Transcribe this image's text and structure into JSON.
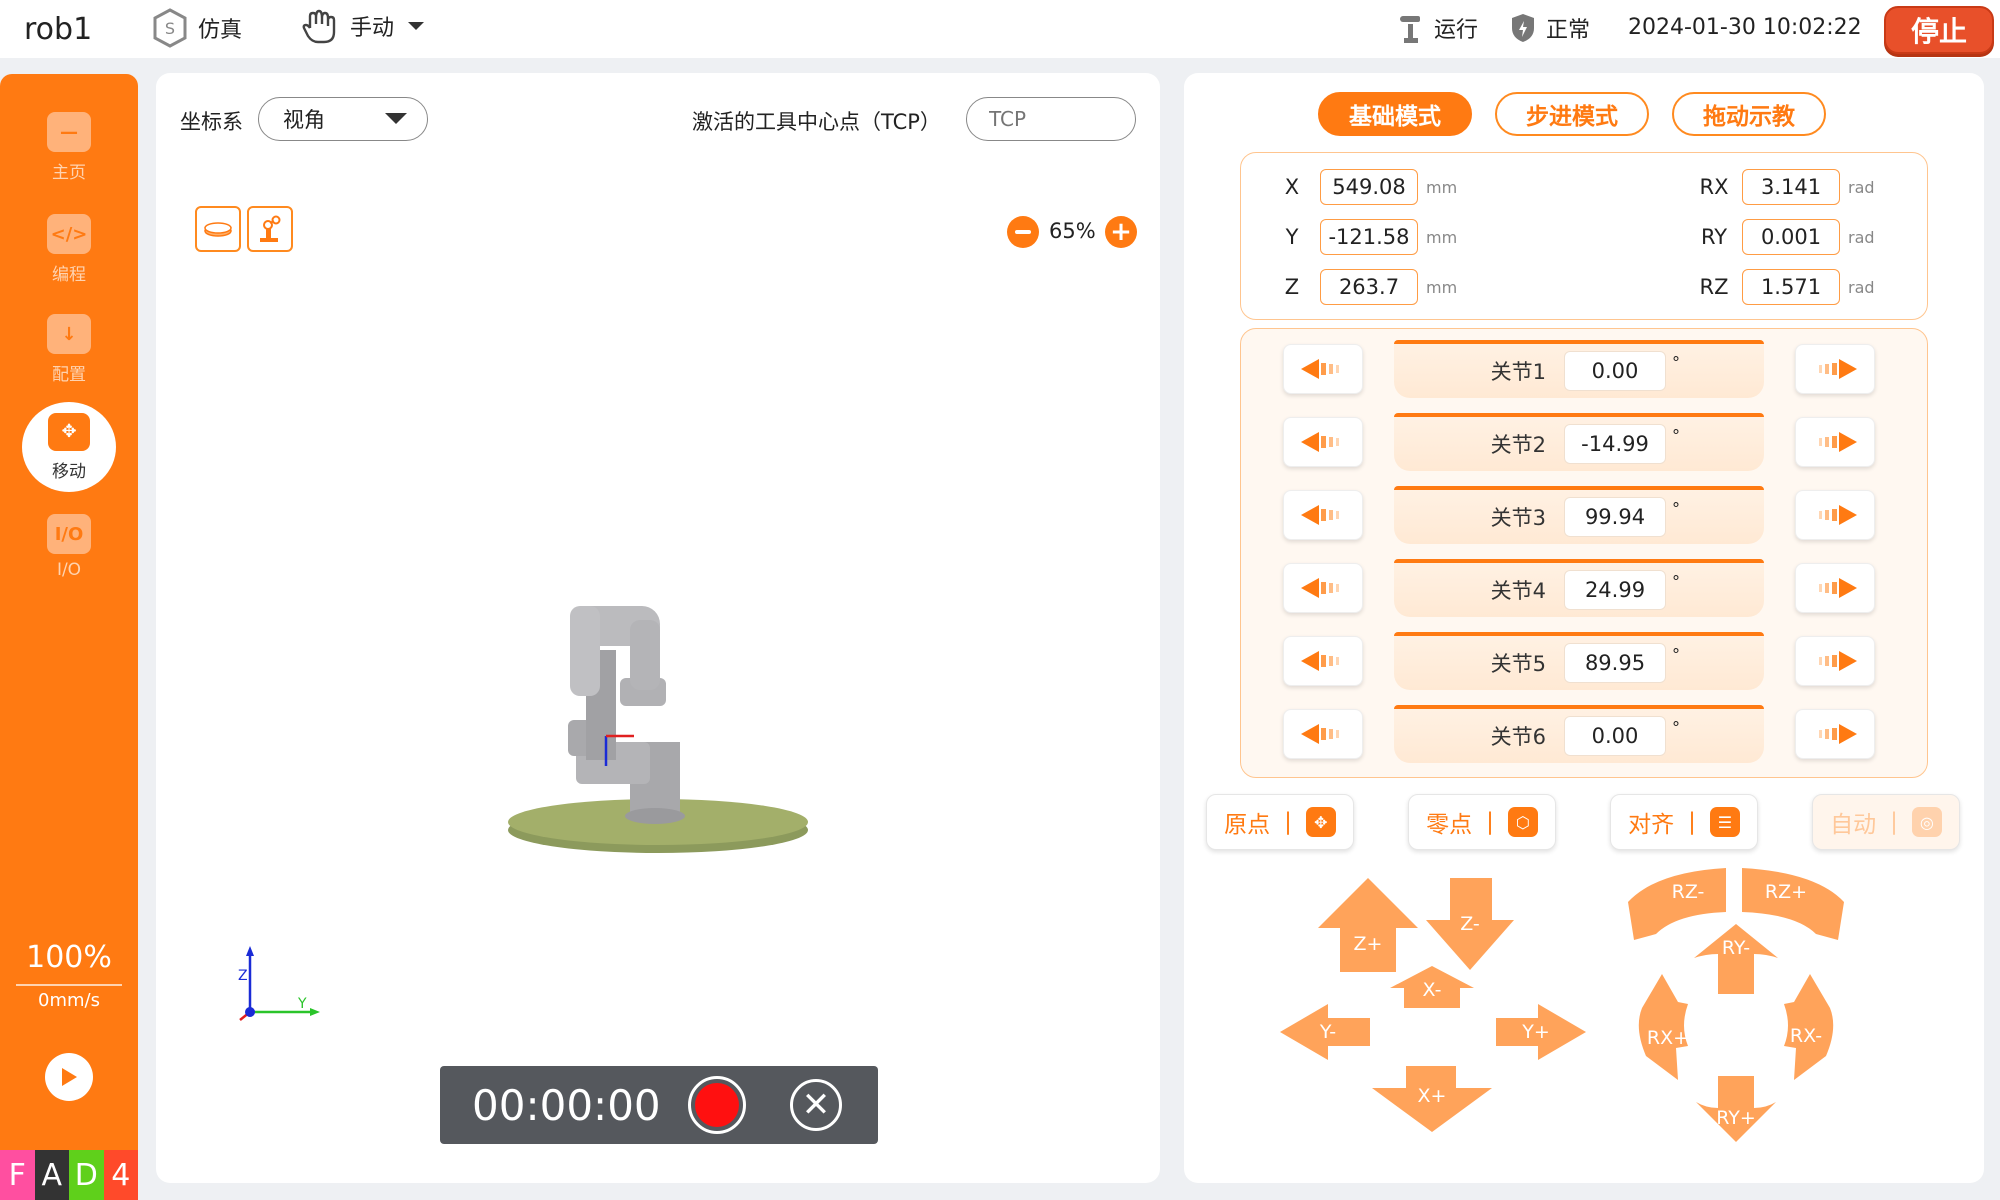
{
  "topbar": {
    "robot_name": "rob1",
    "sim_label": "仿真",
    "manual_label": "手动",
    "run_label": "运行",
    "status_label": "正常",
    "datetime": "2024-01-30 10:02:22",
    "stop_label": "停止"
  },
  "sidebar": {
    "items": [
      {
        "label": "主页",
        "icon": "home-icon"
      },
      {
        "label": "编程",
        "icon": "code-icon"
      },
      {
        "label": "配置",
        "icon": "download-icon"
      },
      {
        "label": "移动",
        "icon": "move-icon"
      },
      {
        "label": "I/O",
        "icon": "io-icon"
      }
    ],
    "speed_percent": "100%",
    "speed_mms": "0mm/s",
    "brand_letters": [
      "F",
      "A",
      "D",
      "4"
    ]
  },
  "viewer": {
    "coord_label": "坐标系",
    "coord_value": "视角",
    "tcp_label": "激活的工具中心点（TCP）",
    "tcp_placeholder": "TCP",
    "zoom": "65%",
    "axis_z": "Z",
    "axis_y": "Y",
    "record_time": "00:00:00"
  },
  "modes": {
    "basic": "基础模式",
    "step": "步进模式",
    "drag": "拖动示教"
  },
  "pose": {
    "x_label": "X",
    "x_value": "549.08",
    "x_unit": "mm",
    "y_label": "Y",
    "y_value": "-121.58",
    "y_unit": "mm",
    "z_label": "Z",
    "z_value": "263.7",
    "z_unit": "mm",
    "rx_label": "RX",
    "rx_value": "3.141",
    "rx_unit": "rad",
    "ry_label": "RY",
    "ry_value": "0.001",
    "ry_unit": "rad",
    "rz_label": "RZ",
    "rz_value": "1.571",
    "rz_unit": "rad"
  },
  "joints": [
    {
      "name": "关节1",
      "value": "0.00",
      "unit": "°"
    },
    {
      "name": "关节2",
      "value": "-14.99",
      "unit": "°"
    },
    {
      "name": "关节3",
      "value": "99.94",
      "unit": "°"
    },
    {
      "name": "关节4",
      "value": "24.99",
      "unit": "°"
    },
    {
      "name": "关节5",
      "value": "89.95",
      "unit": "°"
    },
    {
      "name": "关节6",
      "value": "0.00",
      "unit": "°"
    }
  ],
  "functions": {
    "home": "原点",
    "zero": "零点",
    "align": "对齐",
    "auto": "自动",
    "separator": "|"
  },
  "jog": {
    "z_plus": "Z+",
    "z_minus": "Z-",
    "x_minus": "X-",
    "x_plus": "X+",
    "y_minus": "Y-",
    "y_plus": "Y+",
    "rz_minus": "RZ-",
    "rz_plus": "RZ+",
    "ry_minus": "RY-",
    "ry_plus": "RY+",
    "rx_plus": "RX+",
    "rx_minus": "RX-"
  },
  "colors": {
    "accent": "#ff7a12",
    "stop": "#e8502a",
    "record": "#ff1010"
  }
}
